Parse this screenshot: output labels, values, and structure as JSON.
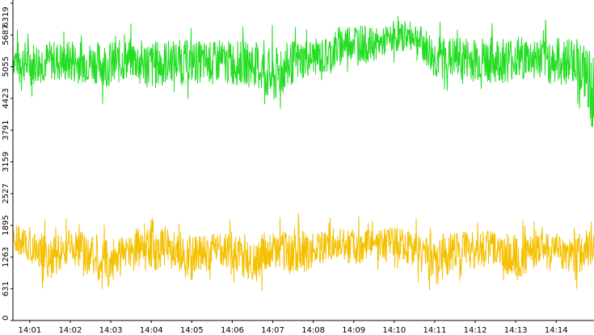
{
  "chart_data": {
    "type": "line",
    "title": "",
    "xlabel": "",
    "ylabel": "",
    "ylim": [
      0,
      6319
    ],
    "y_ticks": [
      0,
      631,
      1263,
      1895,
      2527,
      3159,
      3791,
      4423,
      5055,
      5687,
      6319
    ],
    "x_range": [
      "14:00:35",
      "14:14:56"
    ],
    "x_ticks": [
      "14:01",
      "14:02",
      "14:03",
      "14:04",
      "14:05",
      "14:06",
      "14:07",
      "14:08",
      "14:09",
      "14:10",
      "14:11",
      "14:12",
      "14:13",
      "14:14"
    ],
    "grid": false,
    "legend": "none",
    "series": [
      {
        "color": "#22dd22",
        "points_per_sample": 2,
        "x": [
          "14:00:35",
          "14:01:00",
          "14:01:30",
          "14:02:00",
          "14:02:30",
          "14:03:00",
          "14:03:30",
          "14:04:00",
          "14:04:30",
          "14:05:00",
          "14:05:30",
          "14:06:00",
          "14:06:30",
          "14:07:00",
          "14:07:30",
          "14:08:00",
          "14:08:20",
          "14:08:40",
          "14:09:00",
          "14:09:20",
          "14:09:40",
          "14:10:00",
          "14:10:30",
          "14:11:00",
          "14:11:30",
          "14:12:00",
          "14:12:30",
          "14:13:00",
          "14:13:30",
          "14:14:00",
          "14:14:30",
          "14:14:56"
        ],
        "low": [
          4600,
          4300,
          4450,
          4350,
          4400,
          4250,
          4500,
          4150,
          4400,
          4350,
          4400,
          4300,
          4350,
          3750,
          4350,
          4600,
          4550,
          4700,
          4900,
          4800,
          5000,
          5100,
          5150,
          4400,
          4450,
          4350,
          4300,
          4400,
          4450,
          4250,
          4350,
          3050
        ],
        "high": [
          5850,
          5950,
          5900,
          5950,
          5900,
          5950,
          5950,
          6000,
          5950,
          5950,
          5900,
          5950,
          5950,
          5900,
          5950,
          5900,
          5950,
          6250,
          6300,
          6150,
          6050,
          6150,
          6200,
          6050,
          6000,
          6050,
          6050,
          6050,
          6000,
          6050,
          6050,
          5900
        ]
      },
      {
        "color": "#f5c000",
        "points_per_sample": 2,
        "x": [
          "14:00:35",
          "14:01:00",
          "14:01:30",
          "14:02:00",
          "14:02:30",
          "14:03:00",
          "14:03:30",
          "14:04:00",
          "14:04:30",
          "14:05:00",
          "14:05:30",
          "14:06:00",
          "14:06:30",
          "14:07:00",
          "14:07:30",
          "14:08:00",
          "14:08:20",
          "14:08:40",
          "14:09:00",
          "14:09:20",
          "14:09:40",
          "14:10:00",
          "14:10:30",
          "14:11:00",
          "14:11:30",
          "14:12:00",
          "14:12:30",
          "14:13:00",
          "14:13:30",
          "14:14:00",
          "14:14:30",
          "14:14:56"
        ],
        "low": [
          1000,
          900,
          450,
          900,
          500,
          200,
          800,
          500,
          900,
          250,
          800,
          700,
          250,
          900,
          300,
          800,
          900,
          1000,
          700,
          1000,
          900,
          950,
          800,
          200,
          750,
          700,
          850,
          350,
          800,
          850,
          450,
          900
        ],
        "high": [
          2200,
          2150,
          2000,
          2050,
          2150,
          2050,
          2100,
          2500,
          2050,
          2150,
          2000,
          2100,
          2150,
          2050,
          2300,
          2050,
          2100,
          2200,
          2150,
          2050,
          2100,
          2150,
          2050,
          2150,
          2050,
          2100,
          2050,
          2100,
          2050,
          2000,
          2100,
          2150
        ]
      }
    ]
  }
}
